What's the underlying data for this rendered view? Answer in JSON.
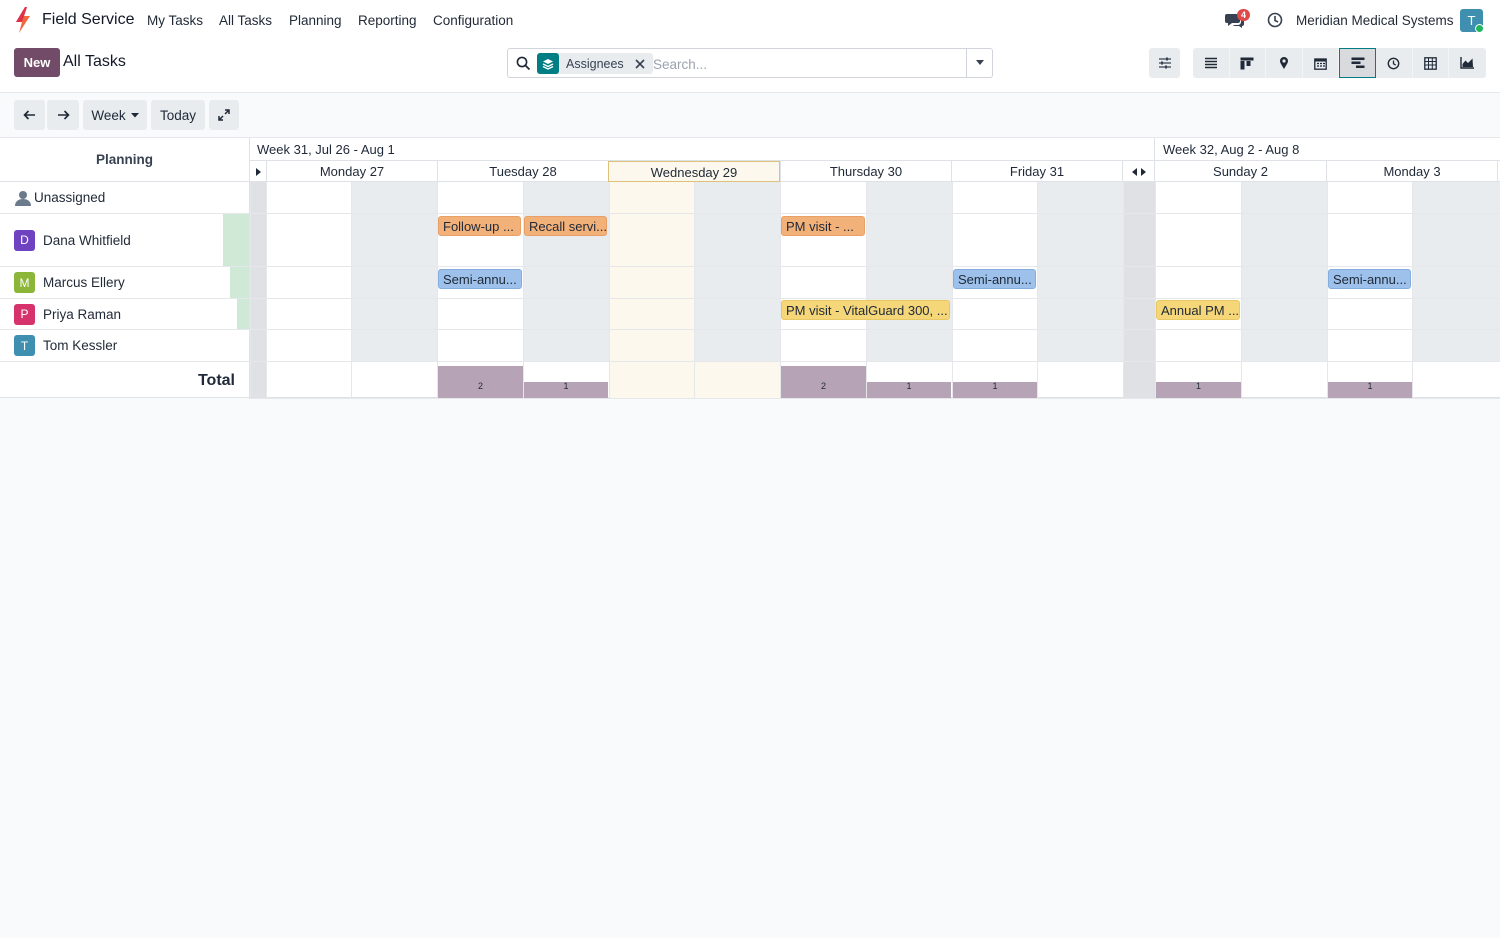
{
  "navbar": {
    "app_name": "Field Service",
    "menu": [
      "My Tasks",
      "All Tasks",
      "Planning",
      "Reporting",
      "Configuration"
    ],
    "chat_badge": "4",
    "company": "Meridian Medical Systems",
    "user_initial": "T"
  },
  "control": {
    "new_label": "New",
    "title": "All Tasks",
    "facet_label": "Assignees",
    "search_placeholder": "Search...",
    "views": [
      "list",
      "kanban",
      "map",
      "calendar",
      "gantt",
      "activity",
      "pivot",
      "graph"
    ],
    "active_view": "gantt"
  },
  "toolbar": {
    "scale": "Week",
    "today": "Today"
  },
  "gantt": {
    "planning_header": "Planning",
    "weeks": [
      "Week 31, Jul 26 - Aug 1",
      "Week 32, Aug 2 - Aug 8"
    ],
    "days": [
      "Monday 27",
      "Tuesday 28",
      "Wednesday 29",
      "Thursday 30",
      "Friday 31",
      "Sunday 2",
      "Monday 3"
    ],
    "today_day": "Wednesday 29",
    "rows": [
      {
        "name": "Unassigned",
        "initial": "",
        "color": ""
      },
      {
        "name": "Dana Whitfield",
        "initial": "D",
        "color": "#6f42c1"
      },
      {
        "name": "Marcus Ellery",
        "initial": "M",
        "color": "#8bb63a"
      },
      {
        "name": "Priya Raman",
        "initial": "P",
        "color": "#d6336c"
      },
      {
        "name": "Tom Kessler",
        "initial": "T",
        "color": "#3f8fb0"
      }
    ],
    "pills": [
      {
        "row": 1,
        "text": "Follow-up ...",
        "color": "orange"
      },
      {
        "row": 1,
        "text": "Recall servi...",
        "color": "orange"
      },
      {
        "row": 1,
        "text": "PM visit - ...",
        "color": "orange"
      },
      {
        "row": 2,
        "text": "Semi-annu...",
        "color": "blue"
      },
      {
        "row": 2,
        "text": "Semi-annu...",
        "color": "blue"
      },
      {
        "row": 2,
        "text": "Semi-annu...",
        "color": "blue"
      },
      {
        "row": 3,
        "text": "PM visit - VitalGuard 300, ...",
        "color": "yellow"
      },
      {
        "row": 3,
        "text": "Annual PM ...",
        "color": "yellow"
      }
    ],
    "total_label": "Total",
    "totals": [
      "2",
      "1",
      "2",
      "1",
      "1",
      "1",
      "1"
    ]
  },
  "colors": {
    "primary": "#714b67",
    "accent": "#017e84",
    "orange_task": "#f3b17a",
    "blue_task": "#9dc1eb",
    "yellow_task": "#f5d77a",
    "total_bar": "#b6a3b5"
  }
}
